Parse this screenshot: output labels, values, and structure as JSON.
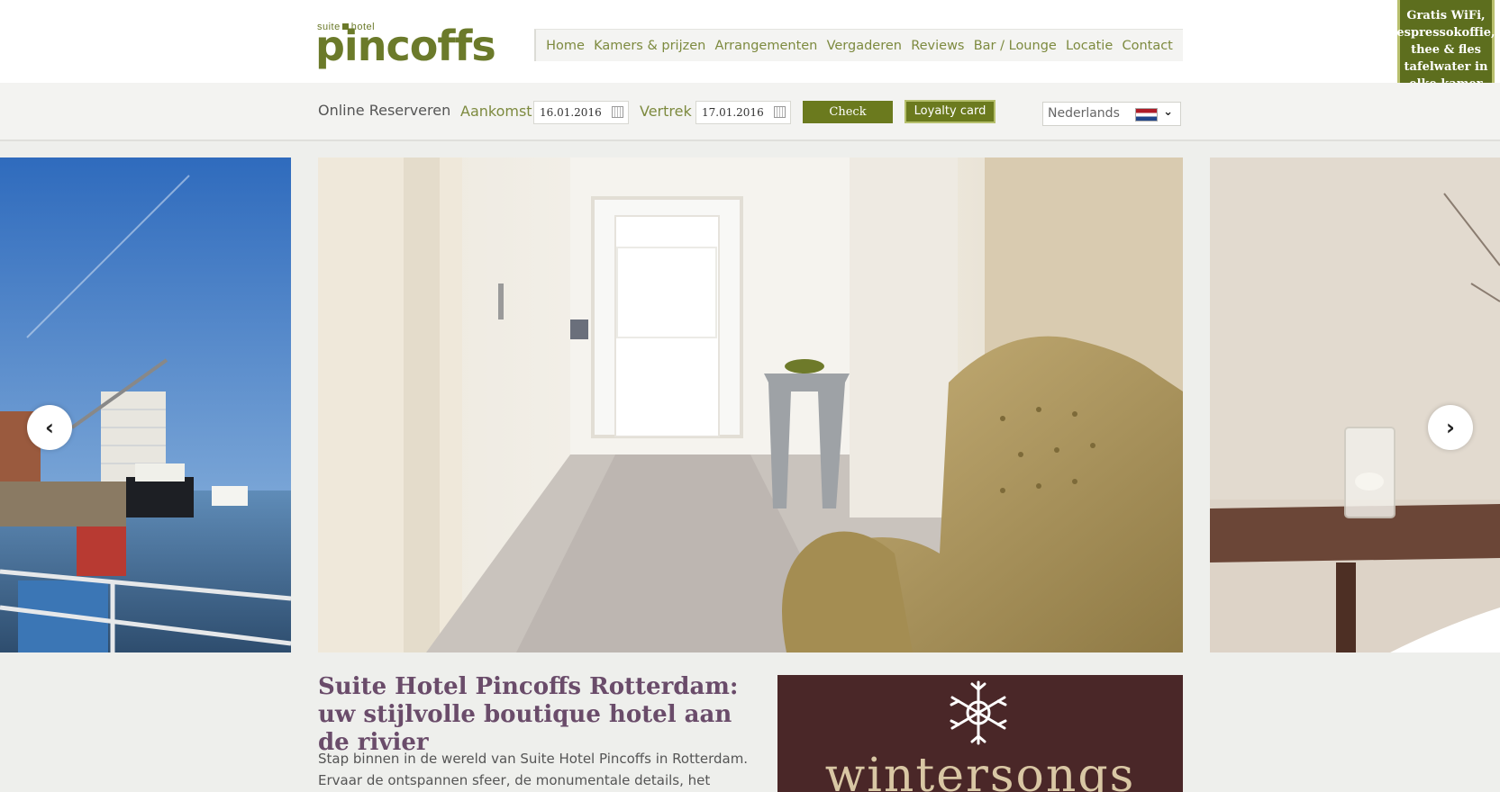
{
  "header": {
    "logo_small_left": "suite",
    "logo_small_right": "hotel",
    "logo_main": "pincoffs",
    "nav": [
      "Home",
      "Kamers & prijzen",
      "Arrangementen",
      "Vergaderen",
      "Reviews",
      "Bar / Lounge",
      "Locatie",
      "Contact"
    ],
    "ribbon_lines": [
      "Gratis WiFi,",
      "espressokoffie,",
      "thee & fles",
      "tafelwater in",
      "elke kamer"
    ]
  },
  "booking": {
    "title": "Online Reserveren",
    "arrival_label": "Aankomst",
    "arrival_value": "16.01.2016",
    "departure_label": "Vertrek",
    "departure_value": "17.01.2016",
    "check_label": "Check",
    "loyalty_label": "Loyalty card",
    "language_value": "Nederlands"
  },
  "slider": {
    "prev_symbol": "‹",
    "next_symbol": "›"
  },
  "content": {
    "title": "Suite Hotel Pincoffs Rotterdam: uw stijlvolle boutique hotel aan de rivier",
    "text": "Stap binnen in de wereld van Suite Hotel Pincoffs in Rotterdam. Ervaar de ontspannen sfeer, de monumentale details, het stijlvolle",
    "promo_text": "wintersongs"
  },
  "colors": {
    "brand_green": "#6b7a1e",
    "nav_text": "#7d8a3f",
    "title_purple": "#6a4c6a",
    "promo_bg": "#4a2728"
  }
}
